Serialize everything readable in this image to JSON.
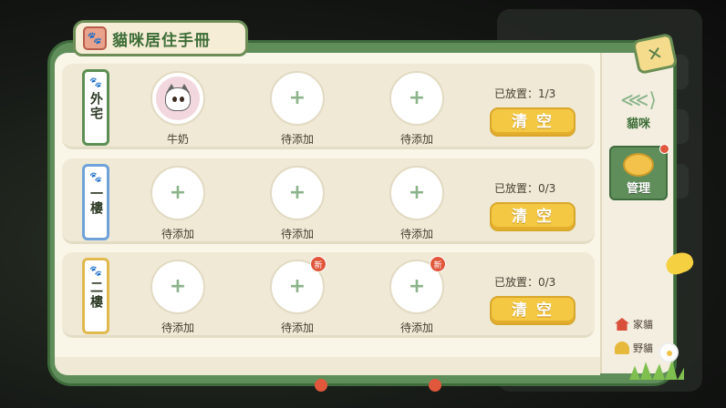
{
  "title": "貓咪居住手冊",
  "floors": [
    {
      "name": "外宅",
      "status": "已放置：1/3",
      "clear_label": "清空",
      "slots": [
        {
          "label": "牛奶",
          "filled": true,
          "new": false
        },
        {
          "label": "待添加",
          "filled": false,
          "new": false
        },
        {
          "label": "待添加",
          "filled": false,
          "new": false
        }
      ]
    },
    {
      "name": "一樓",
      "status": "已放置：0/3",
      "clear_label": "清空",
      "slots": [
        {
          "label": "待添加",
          "filled": false,
          "new": false
        },
        {
          "label": "待添加",
          "filled": false,
          "new": false
        },
        {
          "label": "待添加",
          "filled": false,
          "new": false
        }
      ]
    },
    {
      "name": "二樓",
      "status": "已放置：0/3",
      "clear_label": "清空",
      "slots": [
        {
          "label": "待添加",
          "filled": false,
          "new": false
        },
        {
          "label": "待添加",
          "filled": false,
          "new": true
        },
        {
          "label": "待添加",
          "filled": false,
          "new": true
        }
      ]
    }
  ],
  "new_badge": "新",
  "side_tabs": {
    "cats": "貓咪",
    "manage": "管理"
  },
  "legend": {
    "home": "家貓",
    "wild": "野貓"
  },
  "colors": {
    "frame": "#5f8e5b",
    "button": "#f4c842",
    "badge": "#e0573c"
  }
}
